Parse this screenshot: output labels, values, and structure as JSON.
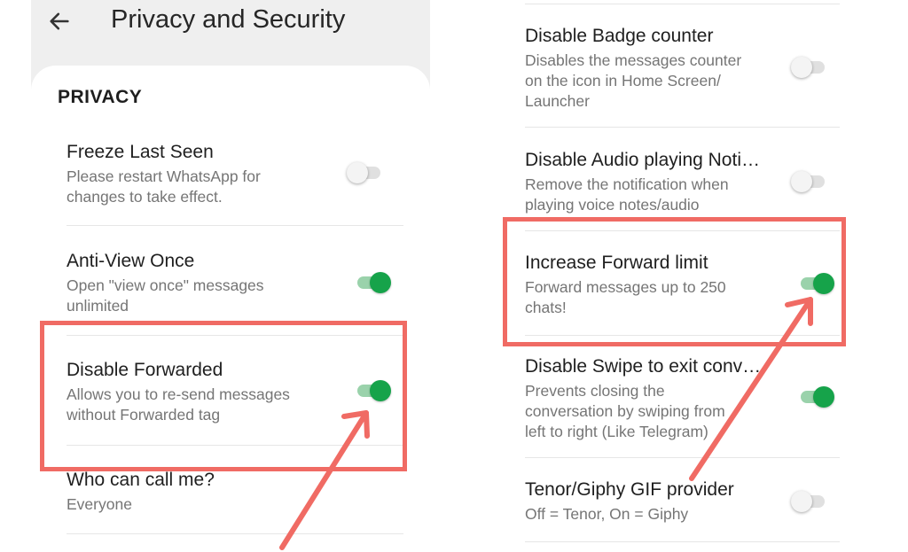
{
  "left": {
    "title": "Privacy and Security",
    "section_header": "PRIVACY",
    "items": [
      {
        "title": "Freeze Last Seen",
        "subtitle_lines": [
          "Please restart WhatsApp for",
          "changes to take effect."
        ],
        "toggle": "off"
      },
      {
        "title": "Anti-View Once",
        "subtitle_lines": [
          "Open \"view once\" messages",
          "unlimited"
        ],
        "toggle": "on"
      },
      {
        "title": "Disable Forwarded",
        "subtitle_lines": [
          "Allows you to re-send messages",
          "without Forwarded tag"
        ],
        "toggle": "on"
      },
      {
        "title": "Who can call me?",
        "subtitle_lines": [
          "Everyone"
        ]
      }
    ]
  },
  "right": {
    "items": [
      {
        "title": "Disable Badge counter",
        "subtitle_lines": [
          "Disables the messages counter",
          "on the icon in Home Screen/",
          "Launcher"
        ],
        "toggle": "off"
      },
      {
        "title": "Disable Audio playing Noti…",
        "subtitle_lines": [
          "Remove the notification when",
          "playing voice notes/audio"
        ],
        "toggle": "off"
      },
      {
        "title": "Increase Forward limit",
        "subtitle_lines": [
          "Forward messages up to 250",
          "chats!"
        ],
        "toggle": "on"
      },
      {
        "title": "Disable Swipe to exit conv…",
        "subtitle_lines": [
          "Prevents closing the",
          "conversation by swiping from",
          "left to right (Like Telegram)"
        ],
        "toggle": "on"
      },
      {
        "title": "Tenor/Giphy GIF provider",
        "subtitle_lines": [
          "Off = Tenor, On = Giphy"
        ],
        "toggle": "off"
      }
    ]
  },
  "icons": {
    "back": "back-arrow-icon"
  },
  "colors": {
    "toggle_on": "#16a34a",
    "toggle_on_track": "#9ad2ab",
    "toggle_off_track": "#e0e0e0",
    "annotation": "#f06b64",
    "header_bg": "#efefef"
  }
}
